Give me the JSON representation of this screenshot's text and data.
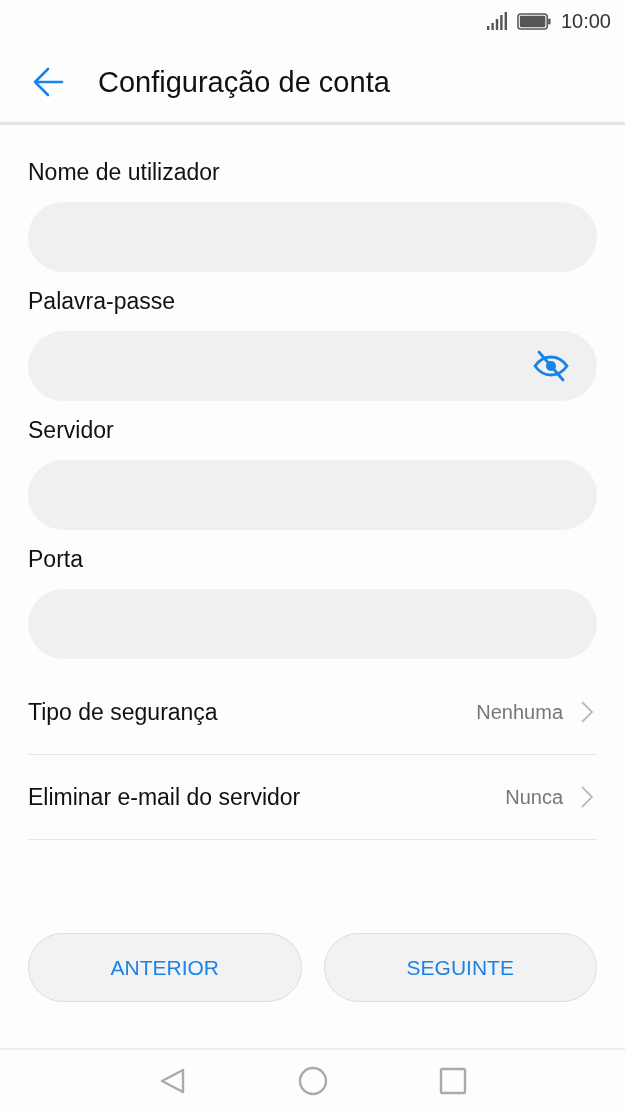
{
  "status_bar": {
    "time": "10:00"
  },
  "header": {
    "title": "Configuração de conta"
  },
  "fields": [
    {
      "label": "Nome de utilizador",
      "kind": "text"
    },
    {
      "label": "Palavra-passe",
      "kind": "password"
    },
    {
      "label": "Servidor",
      "kind": "text"
    },
    {
      "label": "Porta",
      "kind": "text"
    }
  ],
  "settings": [
    {
      "label": "Tipo de segurança",
      "value": "Nenhuma"
    },
    {
      "label": "Eliminar e-mail do servidor",
      "value": "Nunca"
    }
  ],
  "buttons": [
    "ANTERIOR",
    "SEGUINTE"
  ]
}
